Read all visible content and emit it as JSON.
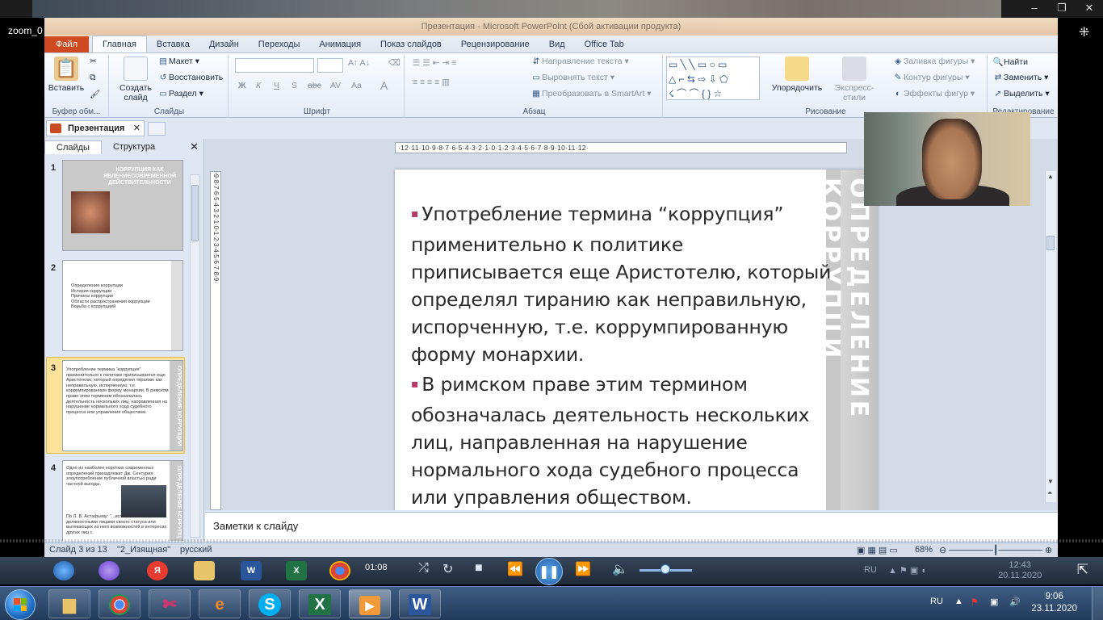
{
  "zoom": {
    "participant_name": "zoom_0"
  },
  "ppt": {
    "window_title": "Презентация - Microsoft PowerPoint (Сбой активации продукта)",
    "tabs": [
      "Файл",
      "Главная",
      "Вставка",
      "Дизайн",
      "Переходы",
      "Анимация",
      "Показ слайдов",
      "Рецензирование",
      "Вид",
      "Office Tab"
    ],
    "ribbon": {
      "clipboard": {
        "paste": "Вставить",
        "group": "Буфер обм..."
      },
      "slides": {
        "new_slide": "Создать слайд",
        "layout": "Макет",
        "reset": "Восстановить",
        "section": "Раздел",
        "group": "Слайды"
      },
      "font": {
        "group": "Шрифт",
        "bold": "Ж",
        "italic": "К",
        "underline": "Ч",
        "strike": "S",
        "abc": "abc",
        "spacing": "AV",
        "case": "Aa"
      },
      "paragraph": {
        "group": "Абзац",
        "text_direction": "Направление текста",
        "align_text": "Выровнять текст",
        "smartart": "Преобразовать в SmartArt"
      },
      "drawing": {
        "group": "Рисование",
        "arrange": "Упорядочить",
        "quick_styles": "Экспресс-стили",
        "fill": "Заливка фигуры",
        "outline": "Контур фигуры",
        "effects": "Эффекты фигур"
      },
      "editing": {
        "group": "Редактирование",
        "find": "Найти",
        "replace": "Заменить",
        "select": "Выделить"
      }
    },
    "doc_tab": "Презентация",
    "pane_tabs": [
      "Слайды",
      "Структура"
    ],
    "thumbnails": [
      {
        "num": "1",
        "title": "КОРРУПЦИЯ КАК ЯВЛЕНИЕСОВРЕМЕННОЙ ДЕЙСТВИТЕЛЬНОСТИ"
      },
      {
        "num": "2",
        "items": [
          "Определение коррупции",
          "История коррупции",
          "Причины коррупции",
          "Области распространения коррупции",
          "Борьба с коррупцией"
        ]
      },
      {
        "num": "3",
        "text": "Употребление термина “коррупция” применительно к политике приписывается еще Аристотелю, который определял тиранию как неправильную, испорченную, т.е. коррумпированную форму монархии. В римском праве этим термином обозначалась деятельность нескольких лиц, направленная на нарушение нормального хода судебного процесса или управления обществом.",
        "side": "ОПРЕДЕЛЕНИЕ КОРРУПЦИИ"
      },
      {
        "num": "4",
        "text1": "Одно из наиболее коротких современных определений принадлежит Дж. Сентурия: злоупотребление публичной властью ради частной выгоды.",
        "text2": "По Л. В. Астафьеву: \"...использование должностными лицами своего статуса или вытекающих из него возможностей в интересах других лиц с",
        "side": "ОПРЕДЕЛЕНИЕ КОРРУПЦ"
      }
    ],
    "hruler": "·12·11·10·9·8·7·6·5·4·3·2·1·0·1·2·3·4·5·6·7·8·9·10·11·12·",
    "vruler": "·9·8·7·6·5·4·3·2·1·0·1·2·3·4·5·6·7·8·9·",
    "slide": {
      "vertical_title": "ОПРЕДЕЛЕНИЕ КОРРУПЦИ",
      "bullets": [
        "Употребление термина “коррупция” применительно к политике приписывается еще Аристотелю, который определял тиранию как неправильную, испорченную, т.е. коррумпированную форму монархии.",
        "В римском праве этим термином обозначалась деятельность нескольких лиц, направленная на нарушение нормального хода судебного процесса или управления обществом."
      ]
    },
    "notes_placeholder": "Заметки к слайду",
    "status": {
      "slide_info": "Слайд 3 из 13",
      "theme": "\"2_Изящная\"",
      "language": "русский",
      "zoom": "68%"
    }
  },
  "player": {
    "time": "01:08",
    "tray_lang": "RU",
    "inner_clock_time": "12:43",
    "inner_clock_date": "20.11.2020"
  },
  "taskbar": {
    "lang": "RU",
    "time": "9:06",
    "date": "23.11.2020"
  },
  "colors": {
    "file_tab": "#d04a21",
    "bullet_accent": "#b43c64",
    "thumb_selected": "#fbe29b",
    "taskbar": "#2b4a70"
  }
}
